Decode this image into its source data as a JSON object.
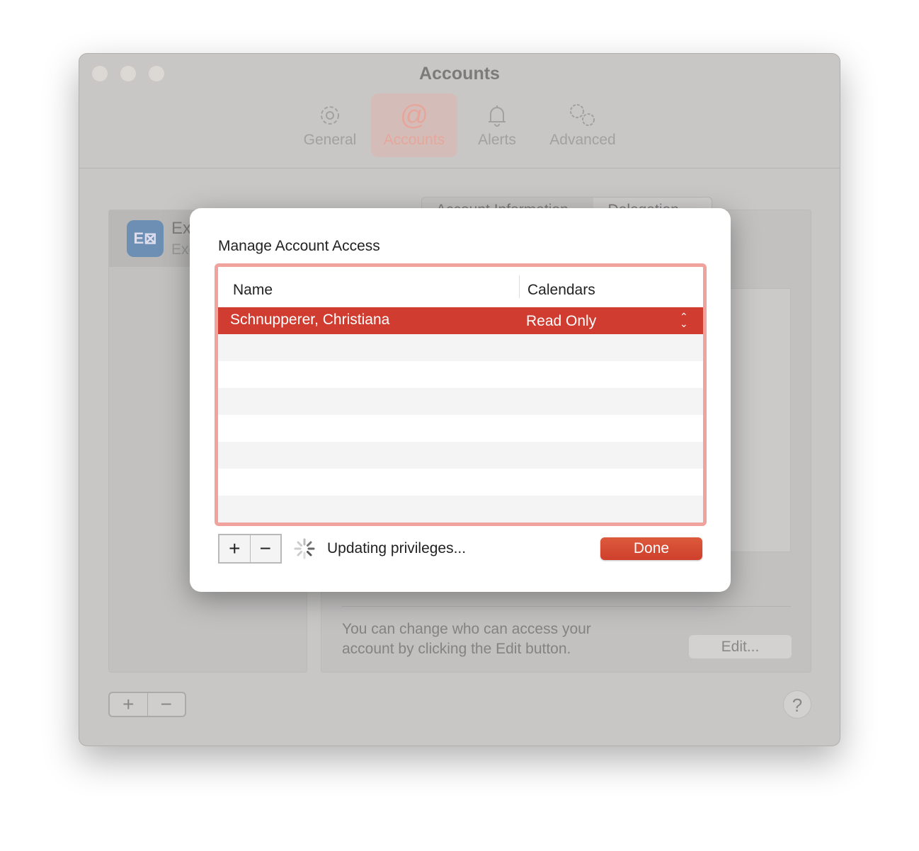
{
  "window": {
    "title": "Accounts"
  },
  "toolbar": {
    "items": [
      {
        "label": "General",
        "icon": "gear-icon"
      },
      {
        "label": "Accounts",
        "icon": "at-icon",
        "selected": true
      },
      {
        "label": "Alerts",
        "icon": "bell-icon"
      },
      {
        "label": "Advanced",
        "icon": "gears-icon"
      }
    ]
  },
  "background": {
    "account_name": "Ex",
    "account_sub": "Exc",
    "tabs": [
      "Account Information",
      "Delegation"
    ],
    "info_text_1": "You can change who can access your",
    "info_text_2": "account by clicking the Edit button.",
    "edit_label": "Edit...",
    "add": "+",
    "remove": "−",
    "help": "?"
  },
  "dialog": {
    "title": "Manage Account Access",
    "columns": [
      "Name",
      "Calendars"
    ],
    "rows": [
      {
        "name": "Schnupperer, Christiana",
        "calendars": "Read Only",
        "selected": true
      }
    ],
    "add": "+",
    "remove": "−",
    "status": "Updating privileges...",
    "done_label": "Done",
    "accent": "#d03c2f"
  }
}
